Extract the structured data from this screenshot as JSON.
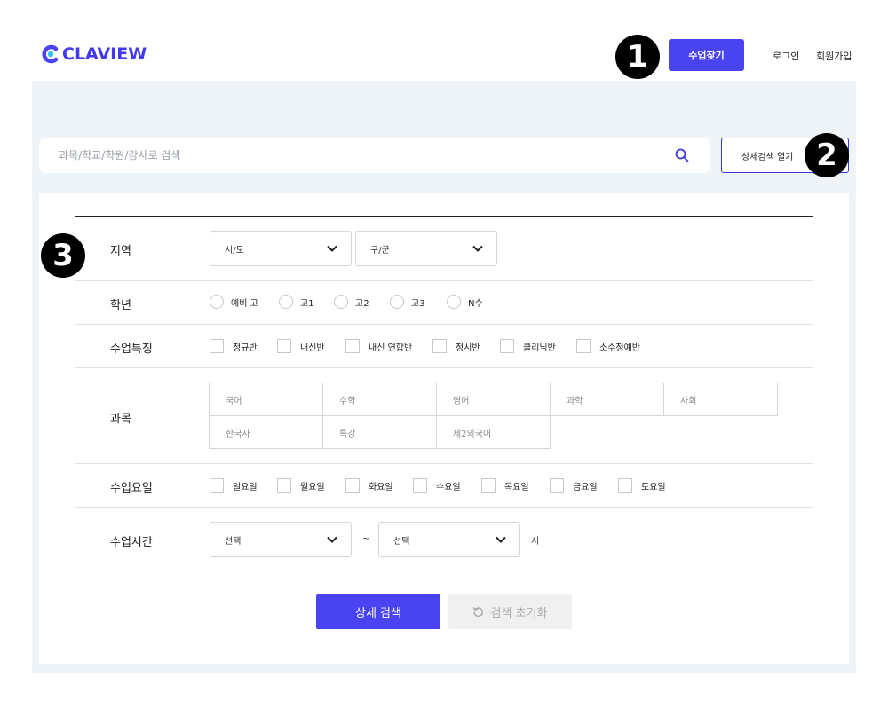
{
  "brand": {
    "logo_text": "CLAVIEW",
    "color": "#4943f1"
  },
  "header": {
    "find_class": "수업찾기",
    "login": "로그인",
    "signup": "회원가입"
  },
  "badges": [
    "1",
    "2",
    "3"
  ],
  "search": {
    "placeholder": "과목/학교/학원/강사로 검색",
    "value": "",
    "detail_toggle": "상세검색 열기"
  },
  "filters": {
    "region": {
      "label": "지역",
      "sido": "시/도",
      "gugun": "구/군"
    },
    "grade": {
      "label": "학년",
      "options": [
        "예비 고",
        "고1",
        "고2",
        "고3",
        "N수"
      ]
    },
    "features": {
      "label": "수업특징",
      "options": [
        "정규반",
        "내신반",
        "내신 연합반",
        "정시반",
        "클리닉반",
        "소수정예반"
      ]
    },
    "subjects": {
      "label": "과목",
      "options": [
        "국어",
        "수학",
        "영어",
        "과학",
        "사회",
        "한국사",
        "특강",
        "제2외국어"
      ]
    },
    "days": {
      "label": "수업요일",
      "options": [
        "일요일",
        "월요일",
        "화요일",
        "수요일",
        "목요일",
        "금요일",
        "토요일"
      ]
    },
    "time": {
      "label": "수업시간",
      "start": "선택",
      "tilde": "~",
      "end": "선택",
      "unit": "시"
    }
  },
  "actions": {
    "search": "상세 검색",
    "reset": "검색 초기화"
  }
}
